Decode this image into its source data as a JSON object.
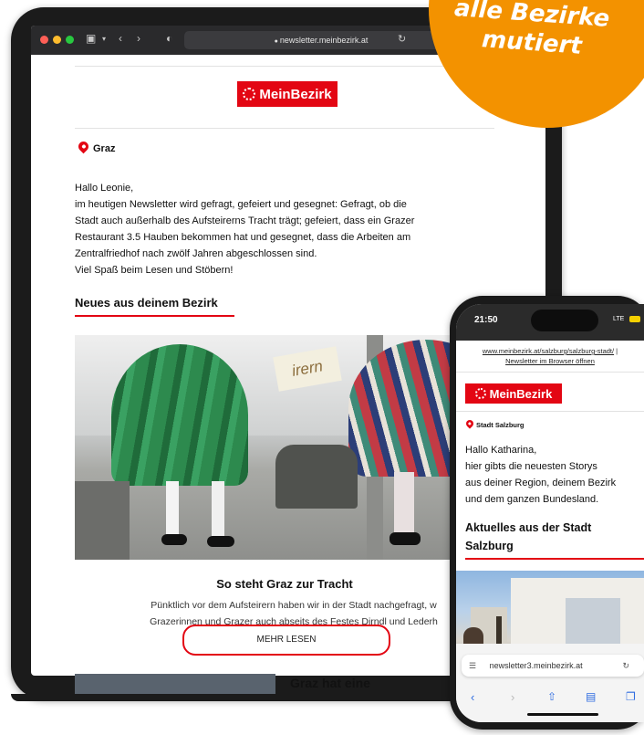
{
  "badge": {
    "line1": "alle Bezirke",
    "line2": "mutiert"
  },
  "tablet": {
    "url": "newsletter.meinbezirk.at",
    "brand": "MeinBezirk",
    "location": "Graz",
    "greeting": "Hallo Leonie,",
    "intro_1": "im heutigen Newsletter wird gefragt, gefeiert und gesegnet: Gefragt, ob die",
    "intro_2": "Stadt auch außerhalb des Aufsteirerns Tracht trägt; gefeiert, dass ein Grazer",
    "intro_3": "Restaurant 3.5 Hauben bekommen hat und gesegnet, dass die Arbeiten am",
    "intro_4": "Zentralfriedhof nach zwölf Jahren abgeschlossen sind.",
    "intro_5": "Viel Spaß beim Lesen und Stöbern!",
    "section_title": "Neues aus deinem Bezirk",
    "photo_sign": "irern",
    "article_title": "So steht Graz zur Tracht",
    "article_text_1": "Pünktlich vor dem Aufsteirern haben wir in der Stadt nachgefragt, w",
    "article_text_2": "Grazerinnen und Grazer auch abseits des Festes Dirndl und Lederh",
    "read_more": "MEHR LESEN",
    "next_title": "Graz hat eine"
  },
  "phone": {
    "time": "21:50",
    "network": "LTE",
    "top_link_1": "www.meinbezirk.at/salzburg/salzburg-stadt/",
    "top_link_sep": " |",
    "top_link_2": "Newsletter im Browser öffnen",
    "brand": "MeinBezirk",
    "location": "Stadt Salzburg",
    "greeting": "Hallo Katharina,",
    "body_1": "hier gibts die neuesten Storys",
    "body_2": "aus deiner Region, deinem Bezirk",
    "body_3": "und dem ganzen Bundesland.",
    "section_1": "Aktuelles aus der Stadt",
    "section_2": "Salzburg",
    "url": "newsletter3.meinbezirk.at"
  },
  "colors": {
    "brand_red": "#e30613",
    "badge_orange": "#f39200"
  },
  "icons": [
    "sidebar-icon",
    "chevron-left-icon",
    "chevron-right-icon",
    "shield-icon",
    "lock-icon",
    "reload-icon",
    "location-pin-icon",
    "gear-logo-icon",
    "reader-icon",
    "share-icon",
    "bookmarks-icon",
    "tabs-icon"
  ]
}
